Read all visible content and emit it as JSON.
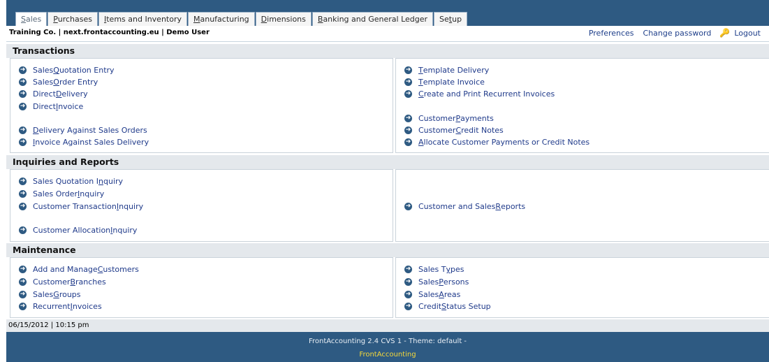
{
  "tabs": [
    {
      "pre": "",
      "u": "S",
      "post": "ales"
    },
    {
      "pre": "",
      "u": "P",
      "post": "urchases"
    },
    {
      "pre": "",
      "u": "I",
      "post": "tems and Inventory"
    },
    {
      "pre": "",
      "u": "M",
      "post": "anufacturing"
    },
    {
      "pre": "",
      "u": "D",
      "post": "imensions"
    },
    {
      "pre": "",
      "u": "B",
      "post": "anking and General Ledger"
    },
    {
      "pre": "Se",
      "u": "t",
      "post": "up"
    }
  ],
  "user_info": "Training Co. | next.frontaccounting.eu | Demo User",
  "links": {
    "preferences": "Preferences",
    "change_password": "Change password",
    "logout": "Logout"
  },
  "sections": {
    "transactions": {
      "title": "Transactions",
      "left": [
        {
          "pre": "Sales ",
          "u": "Q",
          "post": "uotation Entry"
        },
        {
          "pre": "Sales ",
          "u": "O",
          "post": "rder Entry"
        },
        {
          "pre": "Direct ",
          "u": "D",
          "post": "elivery"
        },
        {
          "pre": "Direct ",
          "u": "I",
          "post": "nvoice"
        },
        {
          "pre": "",
          "u": "D",
          "post": "elivery Against Sales Orders"
        },
        {
          "pre": "",
          "u": "I",
          "post": "nvoice Against Sales Delivery"
        }
      ],
      "right": [
        {
          "pre": "",
          "u": "T",
          "post": "emplate Delivery"
        },
        {
          "pre": "",
          "u": "T",
          "post": "emplate Invoice"
        },
        {
          "pre": "",
          "u": "C",
          "post": "reate and Print Recurrent Invoices"
        },
        {
          "pre": "Customer ",
          "u": "P",
          "post": "ayments"
        },
        {
          "pre": "Customer ",
          "u": "C",
          "post": "redit Notes"
        },
        {
          "pre": "",
          "u": "A",
          "post": "llocate Customer Payments or Credit Notes"
        }
      ]
    },
    "inquiries": {
      "title": "Inquiries and Reports",
      "left": [
        {
          "pre": "Sales Quotation I",
          "u": "n",
          "post": "quiry"
        },
        {
          "pre": "Sales Order ",
          "u": "I",
          "post": "nquiry"
        },
        {
          "pre": "Customer Transaction ",
          "u": "I",
          "post": "nquiry"
        },
        {
          "pre": "Customer Allocation ",
          "u": "I",
          "post": "nquiry"
        }
      ],
      "right": [
        {
          "pre": "Customer and Sales ",
          "u": "R",
          "post": "eports"
        }
      ]
    },
    "maintenance": {
      "title": "Maintenance",
      "left": [
        {
          "pre": "Add and Manage ",
          "u": "C",
          "post": "ustomers"
        },
        {
          "pre": "Customer ",
          "u": "B",
          "post": "ranches"
        },
        {
          "pre": "Sales ",
          "u": "G",
          "post": "roups"
        },
        {
          "pre": "Recurrent ",
          "u": "I",
          "post": "nvoices"
        }
      ],
      "right": [
        {
          "pre": "Sales T",
          "u": "y",
          "post": "pes"
        },
        {
          "pre": "Sales ",
          "u": "P",
          "post": "ersons"
        },
        {
          "pre": "Sales ",
          "u": "A",
          "post": "reas"
        },
        {
          "pre": "Credit ",
          "u": "S",
          "post": "tatus Setup"
        }
      ]
    }
  },
  "datetime": "06/15/2012 | 10:15 pm",
  "footer": {
    "version": "FrontAccounting 2.4 CVS 1 - Theme: default -",
    "brand": "FrontAccounting"
  },
  "icons": {
    "link_arrow": "arrow-right-circle-icon",
    "logout": "key-icon"
  }
}
